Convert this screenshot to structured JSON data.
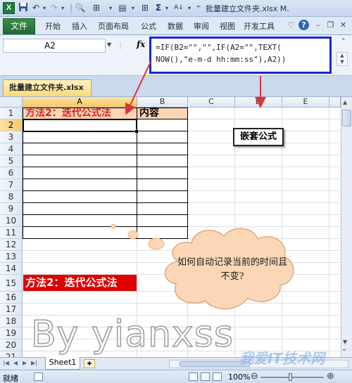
{
  "window": {
    "title": "批量建立文件夹.xlsx M."
  },
  "quick_access": {
    "save_icon": "save-icon",
    "undo_icon": "undo-icon",
    "redo_icon": "redo-icon",
    "sigma_label": "Σ",
    "sort_label": "A↓"
  },
  "ribbon": {
    "tabs": [
      "文件",
      "开始",
      "插入",
      "页面布局",
      "公式",
      "数据",
      "审阅",
      "视图",
      "开发工具"
    ]
  },
  "formula_bar": {
    "name_box": "A2",
    "fx_label": "fx",
    "formula_line1": "=IF(B2=\"\",\"\",IF(A2=\"\",TEXT(",
    "formula_line2": "NOW(),\"e-m-d hh:mm:ss\"),A2))"
  },
  "workbook": {
    "tab_name": "批量建立文件夹.xlsx"
  },
  "grid": {
    "columns": [
      "A",
      "B",
      "C",
      "D",
      "E"
    ],
    "rows": [
      "1",
      "2",
      "3",
      "4",
      "5",
      "6",
      "7",
      "8",
      "9",
      "10",
      "11",
      "12",
      "13",
      "14",
      "15",
      "16",
      "17",
      "18",
      "19",
      "20",
      "21"
    ],
    "cells": {
      "A1": "方法2：迭代公式法",
      "B1": "内容",
      "A15": "方法2：迭代公式法"
    },
    "selected_cell": "A2"
  },
  "annotations": {
    "label_callout": "嵌套公式",
    "cloud_text": "如何自动记录当前的时间且不变?",
    "watermark": "By yianxss",
    "site_watermark": "我爱IT技术网"
  },
  "sheets": {
    "tabs": [
      "Sheet1"
    ]
  },
  "status": {
    "ready": "就绪",
    "zoom": "100%"
  },
  "colors": {
    "accent_blue": "#1427d4",
    "arrow_red": "#d9343a",
    "header_fill": "#fcd5b4",
    "title_red": "#e02020",
    "banner_red": "#e00000"
  }
}
